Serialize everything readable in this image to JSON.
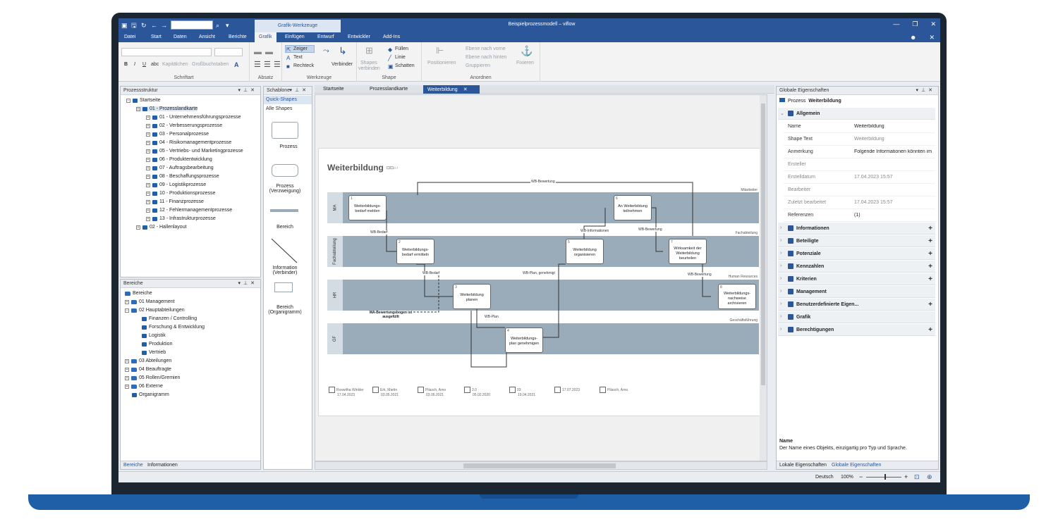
{
  "window": {
    "title": "Beispielprozessmodell – viflow",
    "context_tab": "Grafik-Werkzeuge",
    "controls": [
      "—",
      "❐",
      "✕"
    ]
  },
  "menu": {
    "items": [
      "Datei",
      "Start",
      "Daten",
      "Ansicht",
      "Berichte",
      "Grafik",
      "Einfügen",
      "Entwurf",
      "Entwickler",
      "Add-Ins"
    ],
    "active": "Grafik"
  },
  "ribbon": {
    "font": {
      "buttons": [
        "B",
        "I",
        "U",
        "abc",
        "Kapitälchen",
        "Großbuchstaben",
        "A"
      ],
      "label": "Schriftart"
    },
    "paragraph": {
      "label": "Absatz"
    },
    "tools": {
      "items": [
        "Zeiger",
        "Text",
        "Rechteck"
      ],
      "connector": "Verbinder",
      "label": "Werkzeuge"
    },
    "shape": {
      "connect_shapes": [
        "Shapes",
        "verbinden"
      ],
      "items": [
        "Füllen",
        "Linie",
        "Schatten"
      ],
      "label": "Shape"
    },
    "arrange": {
      "position": "Positionieren",
      "items": [
        "Ebene nach vorne",
        "Ebene nach hinten",
        "Gruppieren"
      ],
      "fix": "Fixieren",
      "label": "Anordnen"
    }
  },
  "process_structure": {
    "title": "Prozessstruktur",
    "root": "Startseite",
    "items": [
      "01 - Prozesslandkarte",
      "01 - Unternehmensführungsprozesse",
      "02 - Verbesserungsprozesse",
      "03 - Personalprozesse",
      "04 - Risikomanagementprozesse",
      "05 - Vertriebs- und Marketingprozesse",
      "06 - Produktentwicklung",
      "07 - Auftragsbearbeitung",
      "08 - Beschaffungsprozesse",
      "09 - Logistikprozesse",
      "10 - Produktionsprozesse",
      "11 - Finanzprozesse",
      "12 - Fehlermanagementprozesse",
      "13 - Infrastrukturprozesse",
      "02 - Hallenlayout"
    ]
  },
  "areas": {
    "title": "Bereiche",
    "items": [
      "Bereiche",
      "01 Management",
      "02 Hauptabteilungen",
      "Finanzen / Controlling",
      "Forschung & Entwicklung",
      "Logistik",
      "Produktion",
      "Vertrieb",
      "03 Abteilungen",
      "04 Beauftragte",
      "05 Rollen/Gremien",
      "06 Externe",
      "Organigramm"
    ],
    "tabs": [
      "Bereiche",
      "Informationen"
    ]
  },
  "stencil": {
    "title": "Schablone",
    "sections": [
      "Quick-Shapes",
      "Alle Shapes"
    ],
    "shapes": [
      "Prozess",
      "Prozess (Verzweigung)",
      "Bereich",
      "Information (Verbinder)",
      "Bereich (Organigramm)"
    ]
  },
  "documents": {
    "tabs": [
      "Startseite",
      "Prozesslandkarte",
      "Weiterbildung"
    ],
    "active": "Weiterbildung"
  },
  "diagram": {
    "title": "Weiterbildung",
    "lanes": [
      {
        "label": "MA",
        "corner": "Mitarbeiter"
      },
      {
        "label": "Fachabteilung",
        "corner": "Fachabteilung"
      },
      {
        "label": "HR",
        "corner": "Human Resources"
      },
      {
        "label": "GF",
        "corner": "Geschäftsführung"
      }
    ],
    "processes": [
      {
        "num": "1",
        "text": "Weiterbildungs-\nbedarf melden"
      },
      {
        "num": "2",
        "text": "Weiterbildungs-\nbedarf ermitteln"
      },
      {
        "num": "3",
        "text": "Weiterbildung\nplanen"
      },
      {
        "num": "4",
        "text": "Weiterbildungs-\nplan genehmigen"
      },
      {
        "num": "5",
        "text": "Weiterbildung\norganisieren"
      },
      {
        "num": "6",
        "text": "An Weiterbildung\nteilnehmen"
      },
      {
        "num": "7",
        "text": "Wirksamkeit der\nWeiterbildung\nbeurteilen"
      },
      {
        "num": "8",
        "text": "Weiterbildungs-\nnachweise\narchivieren"
      }
    ],
    "flows": [
      "WB-Bewertung",
      "WB-Bedarf",
      "WB-Bedarf",
      "WB-Plan",
      "WB-Plan, genehmigt",
      "WB-Informationen",
      "WB-Bewertung",
      "WB-Bewertung"
    ],
    "document_note": "MA-Bewertungsbogen ist ausgefüllt",
    "footer": [
      {
        "name": "Roswitha Winkler",
        "date": "17.04.2023"
      },
      {
        "name": "Erk, Martin",
        "date": "03.05.2021"
      },
      {
        "name": "Pilasch, Arno",
        "date": "03.06.2021"
      },
      {
        "name": "2.0",
        "date": "05.02.2020"
      },
      {
        "name": "03",
        "date": "19.04.2021"
      },
      {
        "name": "",
        "date": "17.07.2023"
      },
      {
        "name": "Pilasch, Arno",
        "date": ""
      }
    ]
  },
  "properties": {
    "title": "Globale Eigenschaften",
    "object_type": "Prozess",
    "object_name": "Weiterbildung",
    "section": "Allgemein",
    "rows": [
      {
        "k": "Name",
        "v": "Weiterbildung"
      },
      {
        "k": "Shape Text",
        "v": "Weiterbildung"
      },
      {
        "k": "Anmerkung",
        "v": "Folgende Informationen könnten im"
      },
      {
        "k": "Ersteller",
        "v": ""
      },
      {
        "k": "Erstelldatum",
        "v": "17.04.2023 15:57"
      },
      {
        "k": "Bearbeiter",
        "v": ""
      },
      {
        "k": "Zuletzt bearbeitet",
        "v": "17.04.2023 15:57"
      },
      {
        "k": "Referenzen",
        "v": "(1)"
      }
    ],
    "groups": [
      "Informationen",
      "Beteiligte",
      "Potenziale",
      "Kennzahlen",
      "Kriterien",
      "Management",
      "Benutzerdefinierte Eigen...",
      "Grafik",
      "Berechtigungen"
    ],
    "help_title": "Name",
    "help_text": "Der Name eines Objekts, einzigartig pro Typ und Sprache.",
    "tabs": [
      "Lokale Eigenschaften",
      "Globale Eigenschaften"
    ]
  },
  "status": {
    "language": "Deutsch",
    "zoom": "100%"
  }
}
